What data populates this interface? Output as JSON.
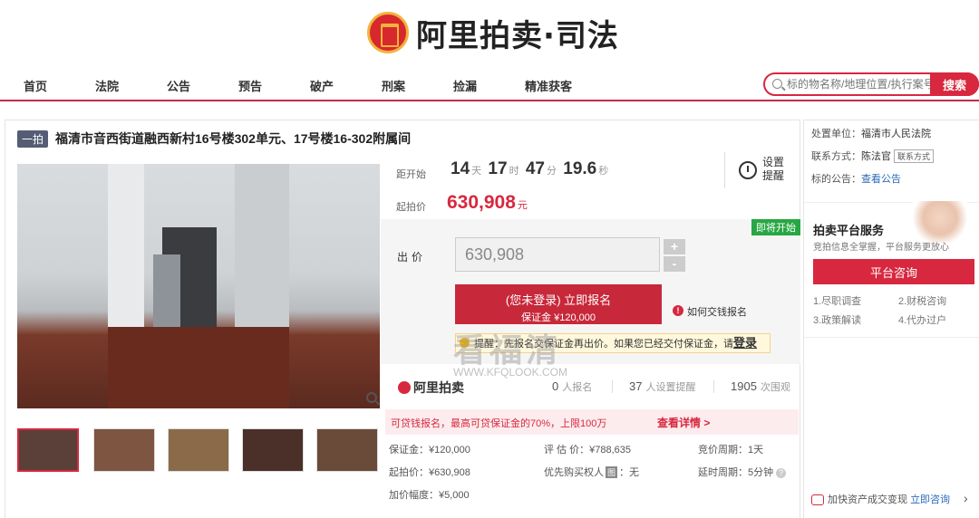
{
  "logo": {
    "text": "阿里拍卖·司法"
  },
  "nav": {
    "items": [
      "首页",
      "法院",
      "公告",
      "预告",
      "破产",
      "刑案",
      "捡漏",
      "精准获客"
    ],
    "search_placeholder": "标的物名称/地理位置/执行案号",
    "search_button": "搜索"
  },
  "item": {
    "tag": "一拍",
    "title": "福清市音西街道融西新村16号楼302单元、17号楼16-302附属间"
  },
  "auction": {
    "countdown_label": "距开始",
    "days": "14",
    "days_unit": "天",
    "hours": "17",
    "hours_unit": "时",
    "minutes": "47",
    "minutes_unit": "分",
    "seconds": "19.6",
    "seconds_unit": "秒",
    "start_price_label": "起拍价",
    "start_price": "630,908",
    "price_unit": "元",
    "remind_label": "设置提醒",
    "soon_badge": "即将开始",
    "bid_label": "出价",
    "bid_value": "630,908",
    "plus": "+",
    "minus": "-",
    "signup_line1": "(您未登录) 立即报名",
    "signup_line2": "保证金 ¥120,000",
    "how_pay": "如何交钱报名",
    "tip_text": "提醒：先报名交保证金再出价。如果您已经交付保证金，请",
    "tip_link": "登录"
  },
  "stats": {
    "brand": "阿里拍卖",
    "signups": "0",
    "signups_label": "人报名",
    "reminders": "37",
    "reminders_label": "人设置提醒",
    "views": "1905",
    "views_label": "次围观"
  },
  "loan": {
    "text": "可贷钱报名，最高可贷保证金的70%，上限100万",
    "link": "查看详情 >"
  },
  "details": {
    "deposit": "保证金：¥120,000",
    "appraisal": "评 估 价：¥788,635",
    "cycle": "竞价周期：1天",
    "start_price": "起拍价：¥630,908",
    "priority_label": "优先购买权人",
    "priority_badge": "图",
    "priority_value": "：无",
    "delay": "延时周期：5分钟",
    "increment": "加价幅度：¥5,000"
  },
  "watermark": {
    "text": "看福清",
    "url": "WWW.KFQLOOK.COM"
  },
  "sidebar": {
    "unit_label": "处置单位：",
    "unit_value": "福清市人民法院",
    "contact_label": "联系方式：",
    "contact_value": "陈法官",
    "contact_chip": "联系方式",
    "notice_label": "标的公告：",
    "notice_link": "查看公告",
    "service_title": "拍卖平台服务",
    "service_sub": "竞拍信息全掌握，平台服务更放心",
    "service_button": "平台咨询",
    "service_items": [
      "1.尽职调查",
      "2.财税咨询",
      "3.政策解读",
      "4.代办过户"
    ],
    "bottom_text": "加快资产成交变现",
    "bottom_link": "立即咨询"
  }
}
